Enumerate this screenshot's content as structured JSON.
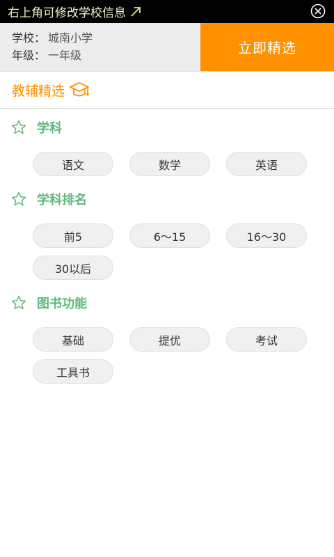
{
  "banner": {
    "text": "右上角可修改学校信息"
  },
  "info": {
    "school_label": "学校：",
    "school_value": "城南小学",
    "grade_label": "年级：",
    "grade_value": "一年级",
    "select_button": "立即精选"
  },
  "section": {
    "title": "教辅精选"
  },
  "groups": [
    {
      "title": "学科",
      "options": [
        "语文",
        "数学",
        "英语"
      ]
    },
    {
      "title": "学科排名",
      "options": [
        "前5",
        "6～15",
        "16～30",
        "30以后"
      ]
    },
    {
      "title": "图书功能",
      "options": [
        "基础",
        "提优",
        "考试",
        "工具书"
      ]
    }
  ],
  "colors": {
    "accent_orange": "#ff9000",
    "group_green": "#5fb97a",
    "banner_text": "#e7f4c9"
  },
  "icons": [
    "arrow-up-right-icon",
    "close-circle-icon",
    "graduation-cap-icon",
    "star-outline-icon"
  ]
}
